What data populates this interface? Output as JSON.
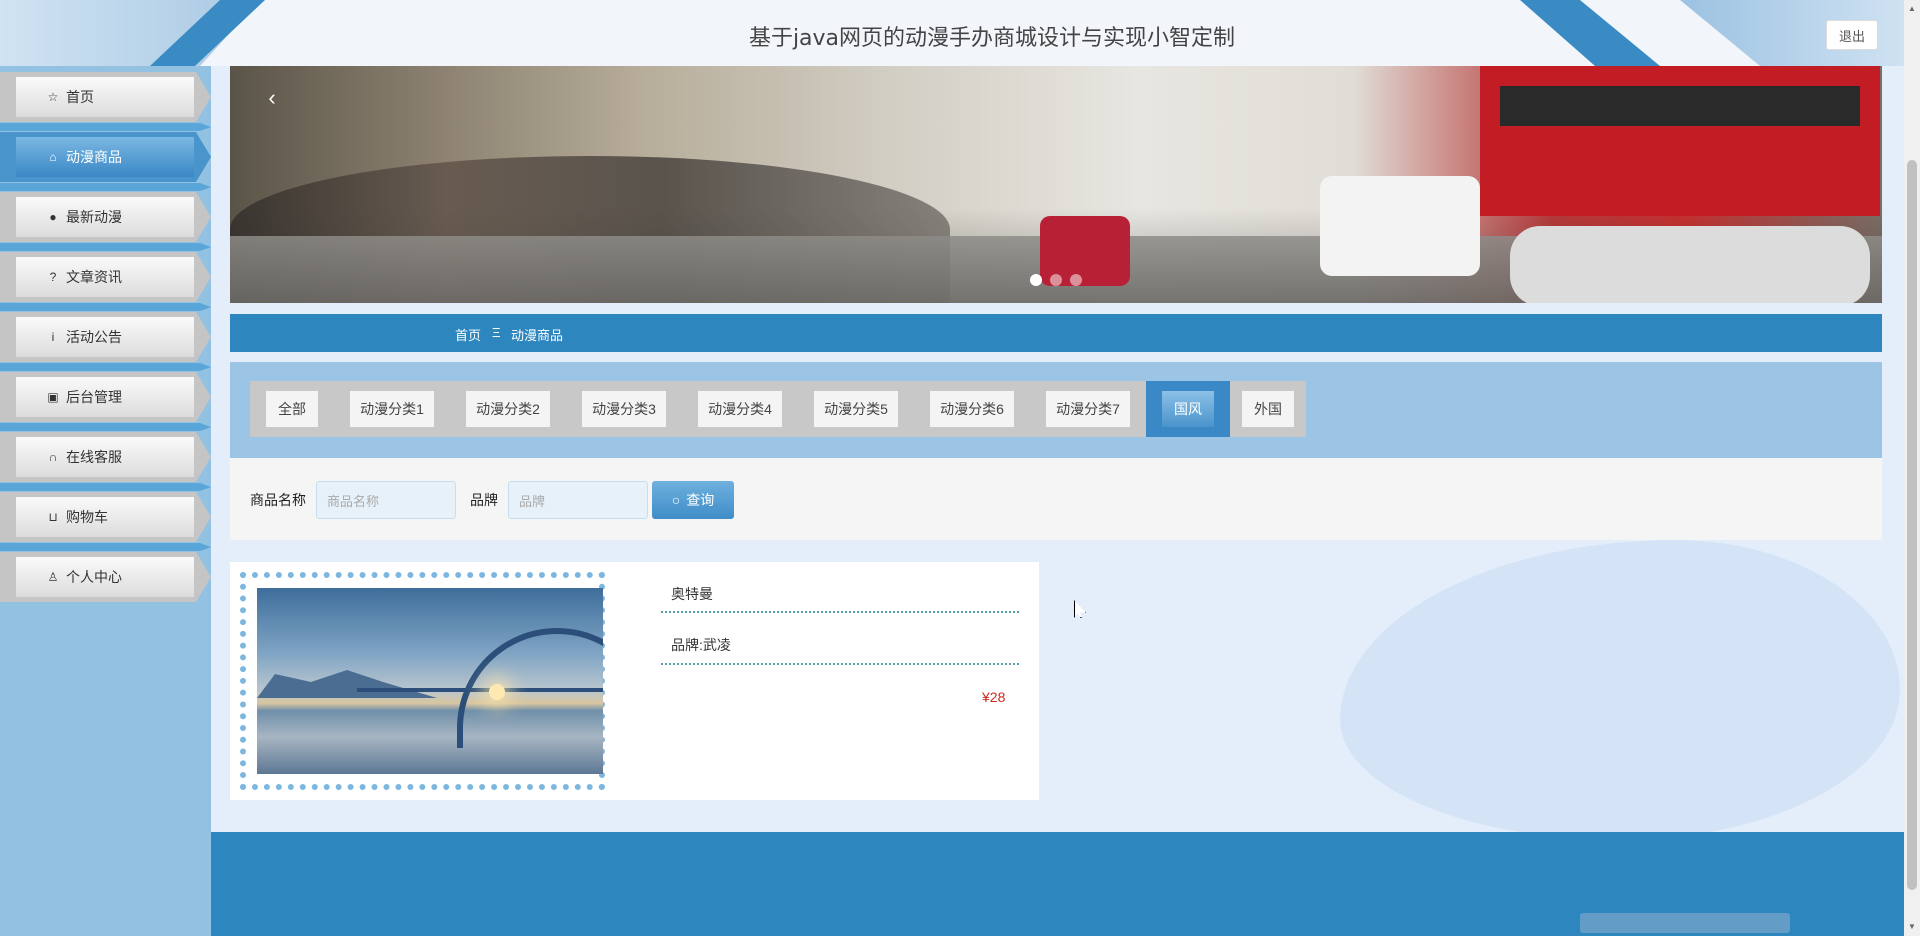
{
  "header": {
    "title": "基于java网页的动漫手办商城设计与实现小智定制",
    "logout_label": "退出"
  },
  "sidebar": {
    "items": [
      {
        "label": "首页",
        "icon": "star-icon"
      },
      {
        "label": "动漫商品",
        "icon": "bag-icon",
        "active": true
      },
      {
        "label": "最新动漫",
        "icon": "alert-icon"
      },
      {
        "label": "文章资讯",
        "icon": "question-icon"
      },
      {
        "label": "活动公告",
        "icon": "info-icon"
      },
      {
        "label": "后台管理",
        "icon": "briefcase-icon"
      },
      {
        "label": "在线客服",
        "icon": "headset-icon"
      },
      {
        "label": "购物车",
        "icon": "cart-icon"
      },
      {
        "label": "个人中心",
        "icon": "user-icon"
      }
    ]
  },
  "carousel": {
    "prev_arrow": "‹",
    "slide_count": 3,
    "active_index": 0
  },
  "breadcrumb": {
    "home": "首页",
    "separator": "Ξ",
    "current": "动漫商品"
  },
  "categories": {
    "items": [
      "全部",
      "动漫分类1",
      "动漫分类2",
      "动漫分类3",
      "动漫分类4",
      "动漫分类5",
      "动漫分类6",
      "动漫分类7",
      "国风",
      "外国"
    ],
    "active": "国风"
  },
  "search": {
    "name_label": "商品名称",
    "name_placeholder": "商品名称",
    "brand_label": "品牌",
    "brand_placeholder": "品牌",
    "button_label": "查询"
  },
  "product": {
    "name": "奥特曼",
    "brand": "品牌:武凌",
    "price": "¥28"
  },
  "colors": {
    "primary": "#2e86bf",
    "sidebar_bg": "#92c1e2",
    "price": "#d0281f"
  }
}
